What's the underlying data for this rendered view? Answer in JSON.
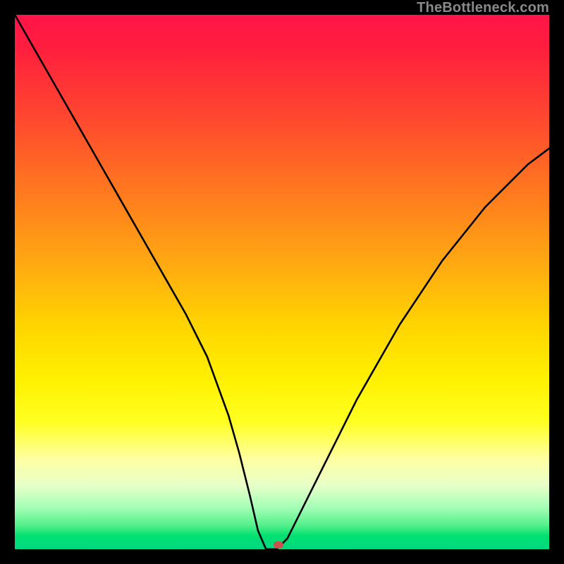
{
  "watermark": "TheBottleneck.com",
  "chart_data": {
    "type": "line",
    "title": "",
    "xlabel": "",
    "ylabel": "",
    "xlim": [
      0,
      100
    ],
    "ylim": [
      0,
      100
    ],
    "series": [
      {
        "name": "bottleneck-curve",
        "x": [
          0,
          4,
          8,
          12,
          16,
          20,
          24,
          28,
          32,
          36,
          40,
          42,
          44,
          45.5,
          47,
          49,
          51,
          53,
          56,
          60,
          64,
          68,
          72,
          76,
          80,
          84,
          88,
          92,
          96,
          100
        ],
        "y": [
          100,
          93,
          86,
          79,
          72,
          65,
          58,
          51,
          44,
          36,
          25,
          18,
          10,
          3.5,
          0,
          0,
          2,
          6,
          12,
          20,
          28,
          35,
          42,
          48,
          54,
          59,
          64,
          68,
          72,
          75
        ]
      }
    ],
    "marker": {
      "x": 49.3,
      "y": 0.8,
      "color": "#c9524e"
    },
    "background_gradient": [
      "#ff1448",
      "#ff4a2e",
      "#ff7c1e",
      "#ffae10",
      "#ffd400",
      "#fff000",
      "#ffff20",
      "#ffffa0",
      "#e8ffc8",
      "#a8ffb8",
      "#55f08c",
      "#00e070",
      "#00d882"
    ],
    "frame_color": "#000000"
  }
}
